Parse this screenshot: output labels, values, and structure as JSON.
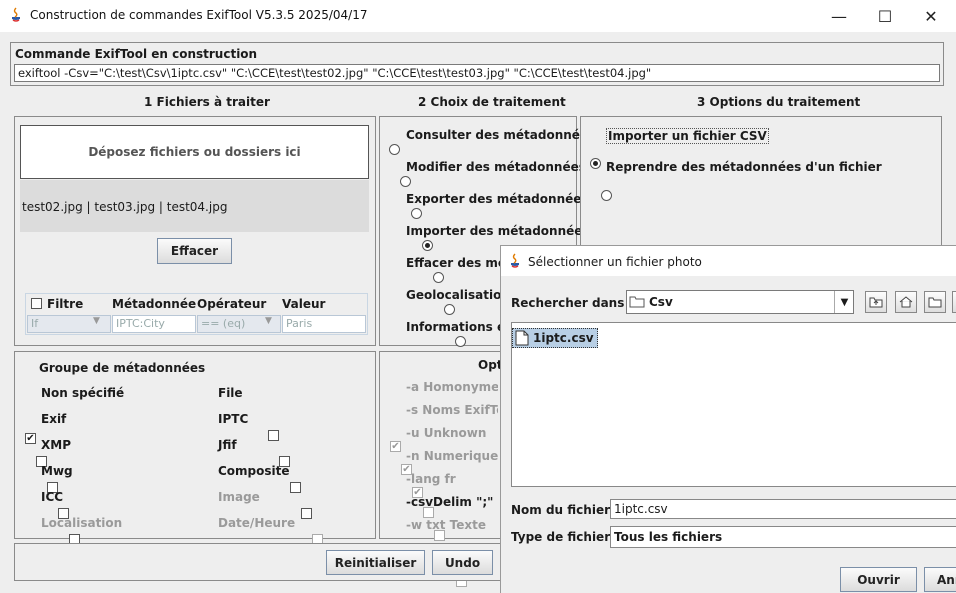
{
  "window": {
    "title": "Construction de commandes ExifTool V5.3.5 2025/04/17",
    "minimize": "—",
    "maximize": "☐",
    "close": "✕"
  },
  "command": {
    "label": "Commande ExifTool en construction",
    "value": "exiftool  -Csv=\"C:\\test\\Csv\\1iptc.csv\" \"C:\\CCE\\test\\test02.jpg\" \"C:\\CCE\\test\\test03.jpg\" \"C:\\CCE\\test\\test04.jpg\""
  },
  "headers": {
    "files": "1  Fichiers à traiter",
    "choice": "2  Choix de traitement",
    "options": "3 Options du traitement"
  },
  "files": {
    "drop_label": "Déposez fichiers ou dossiers ici",
    "list": "test02.jpg | test03.jpg | test04.jpg",
    "clear_button": "Effacer",
    "filter": {
      "filter_label": "Filtre",
      "metadata_label": "Métadonnée",
      "operator_label": "Opérateur",
      "value_label": "Valeur",
      "if_value": "If",
      "tag_value": "IPTC:City",
      "op_value": "== (eq)",
      "val_value": "Paris"
    }
  },
  "choices": [
    {
      "label": "Consulter des métadonnées",
      "selected": false
    },
    {
      "label": "Modifier des métadonnées",
      "selected": false
    },
    {
      "label": "Exporter des métadonnées",
      "selected": false
    },
    {
      "label": "Importer des métadonnées",
      "selected": true
    },
    {
      "label": "Effacer des métadonnées",
      "selected": false
    },
    {
      "label": "Geolocalisation",
      "selected": false
    },
    {
      "label": "Informations et p",
      "selected": false
    }
  ],
  "options3": [
    {
      "label": "Importer un fichier CSV",
      "selected": true
    },
    {
      "label": "Reprendre des métadonnées d'un fichier",
      "selected": false
    }
  ],
  "groups": {
    "title": "Groupe de métadonnées",
    "left": [
      {
        "label": "Non spécifié",
        "checked": true,
        "enabled": true
      },
      {
        "label": "Exif",
        "checked": false,
        "enabled": true
      },
      {
        "label": "XMP",
        "checked": false,
        "enabled": true
      },
      {
        "label": "Mwg",
        "checked": false,
        "enabled": true
      },
      {
        "label": "ICC",
        "checked": false,
        "enabled": true
      },
      {
        "label": "Localisation",
        "checked": false,
        "enabled": false
      }
    ],
    "right": [
      {
        "label": "File",
        "checked": false,
        "enabled": true
      },
      {
        "label": "IPTC",
        "checked": false,
        "enabled": true
      },
      {
        "label": "Jfif",
        "checked": false,
        "enabled": true
      },
      {
        "label": "Composite",
        "checked": false,
        "enabled": true
      },
      {
        "label": "Image",
        "checked": false,
        "enabled": false
      },
      {
        "label": "Date/Heure",
        "checked": false,
        "enabled": false
      }
    ]
  },
  "opt_panel": {
    "title": "Opt",
    "items": [
      {
        "label": "-a Homonymes",
        "checked": true,
        "enabled": false
      },
      {
        "label": "-s Noms ExifToo",
        "checked": true,
        "enabled": false
      },
      {
        "label": "-u Unknown",
        "checked": true,
        "enabled": false
      },
      {
        "label": "-n Numerique",
        "checked": false,
        "enabled": false
      },
      {
        "label": "-lang fr",
        "checked": false,
        "enabled": false
      },
      {
        "label": "-csvDelim \";\"",
        "checked": false,
        "enabled": true
      },
      {
        "label": "-w txt Texte",
        "checked": false,
        "enabled": false
      }
    ]
  },
  "bottom": {
    "reset_button": "Reinitialiser",
    "undo_button": "Undo"
  },
  "dialog": {
    "title": "Sélectionner un fichier photo",
    "look_in_label": "Rechercher dans :",
    "look_in_value": "Csv",
    "file_item": "1iptc.csv",
    "filename_label": "Nom du fichier :",
    "filename_value": "1iptc.csv",
    "filetype_label": "Type de fichier :",
    "filetype_value": "Tous les fichiers",
    "open_button": "Ouvrir",
    "cancel_button": "Annuler"
  }
}
